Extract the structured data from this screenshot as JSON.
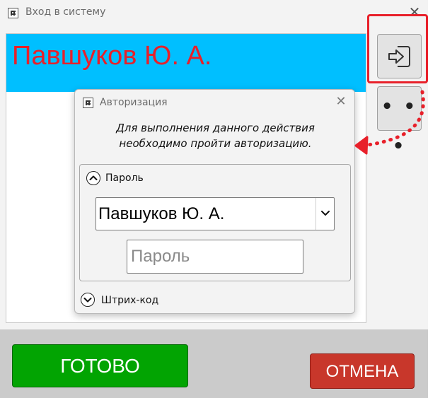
{
  "window": {
    "title": "Вход в систему",
    "close_glyph": "✕"
  },
  "list": {
    "selected_user": "Павшуков Ю. А."
  },
  "side_buttons": {
    "login_icon": "login-arrow-icon",
    "more_label": "• • •"
  },
  "bottom": {
    "ok_label": "ГОТОВО",
    "cancel_label": "ОТМЕНА"
  },
  "dialog": {
    "title": "Авторизация",
    "close_glyph": "✕",
    "message_line1": "Для выполнения данного действия",
    "message_line2": "необходимо пройти авторизацию.",
    "password_section": {
      "label": "Пароль",
      "toggle_icon": "chevron-up-icon",
      "user_select_value": "Павшуков Ю. А.",
      "password_placeholder": "Пароль"
    },
    "barcode_section": {
      "label": "Штрих-код",
      "toggle_icon": "chevron-down-icon"
    }
  },
  "colors": {
    "selection_bg": "#00bfff",
    "selection_text": "#e8202a",
    "ok_bg": "#02a402",
    "cancel_bg": "#c8372b",
    "annotation": "#e8202a"
  }
}
